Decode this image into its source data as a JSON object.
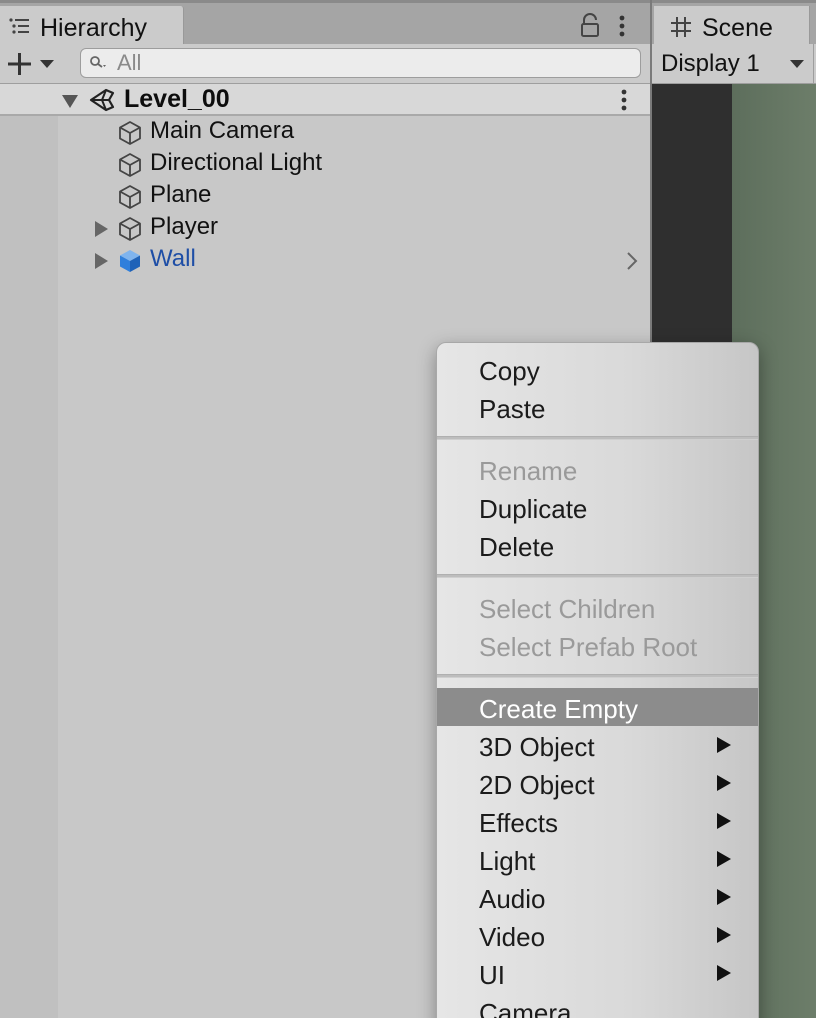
{
  "hierarchy": {
    "tab_label": "Hierarchy",
    "search": {
      "placeholder": "All",
      "value": ""
    },
    "scene": {
      "name": "Level_00"
    },
    "items": [
      {
        "label": "Main Camera",
        "expandable": false,
        "prefab": false
      },
      {
        "label": "Directional Light",
        "expandable": false,
        "prefab": false
      },
      {
        "label": "Plane",
        "expandable": false,
        "prefab": false
      },
      {
        "label": "Player",
        "expandable": true,
        "prefab": false
      },
      {
        "label": "Wall",
        "expandable": true,
        "prefab": true
      }
    ]
  },
  "scene_panel": {
    "tab_label": "Scene",
    "display_dropdown": "Display 1"
  },
  "context_menu": {
    "groups": [
      [
        {
          "label": "Copy",
          "enabled": true
        },
        {
          "label": "Paste",
          "enabled": true
        }
      ],
      [
        {
          "label": "Rename",
          "enabled": false
        },
        {
          "label": "Duplicate",
          "enabled": true
        },
        {
          "label": "Delete",
          "enabled": true
        }
      ],
      [
        {
          "label": "Select Children",
          "enabled": false
        },
        {
          "label": "Select Prefab Root",
          "enabled": false
        }
      ],
      [
        {
          "label": "Create Empty",
          "enabled": true,
          "highlighted": true,
          "submenu": false
        },
        {
          "label": "3D Object",
          "enabled": true,
          "submenu": true
        },
        {
          "label": "2D Object",
          "enabled": true,
          "submenu": true
        },
        {
          "label": "Effects",
          "enabled": true,
          "submenu": true
        },
        {
          "label": "Light",
          "enabled": true,
          "submenu": true
        },
        {
          "label": "Audio",
          "enabled": true,
          "submenu": true
        },
        {
          "label": "Video",
          "enabled": true,
          "submenu": true
        },
        {
          "label": "UI",
          "enabled": true,
          "submenu": true
        },
        {
          "label": "Camera",
          "enabled": true,
          "submenu": false
        }
      ]
    ]
  },
  "colors": {
    "prefab_text": "#1e4ea6",
    "prefab_icon": "#2f7fdc",
    "menu_highlight": "#8c8c8c",
    "disabled_text": "#9a9a9a"
  },
  "icons": {
    "hierarchy_tab": "list-icon",
    "lock": "lock-icon",
    "menu": "kebab-menu-icon",
    "add": "plus-icon",
    "search": "search-icon",
    "scene_root": "unity-logo-icon",
    "game_object": "cube-icon",
    "prefab": "prefab-cube-icon",
    "scene_tab": "grid-icon",
    "submenu": "triangle-right-icon"
  }
}
